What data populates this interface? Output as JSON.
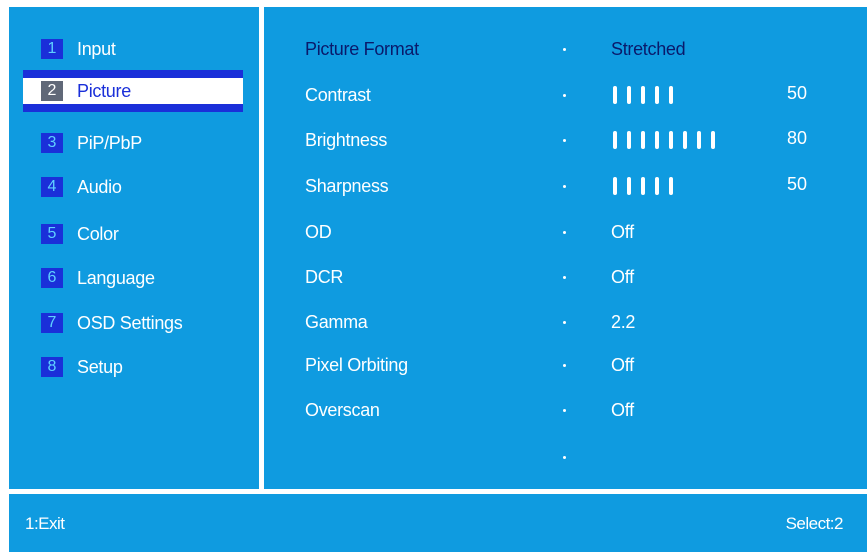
{
  "menu": [
    {
      "num": "1",
      "label": "Input"
    },
    {
      "num": "2",
      "label": "Picture"
    },
    {
      "num": "3",
      "label": "PiP/PbP"
    },
    {
      "num": "4",
      "label": "Audio"
    },
    {
      "num": "5",
      "label": "Color"
    },
    {
      "num": "6",
      "label": "Language"
    },
    {
      "num": "7",
      "label": "OSD Settings"
    },
    {
      "num": "8",
      "label": "Setup"
    }
  ],
  "settings": [
    {
      "name": "Picture Format",
      "value": "Stretched"
    },
    {
      "name": "Contrast",
      "bar_level": 50,
      "number": "50"
    },
    {
      "name": "Brightness",
      "bar_level": 80,
      "number": "80"
    },
    {
      "name": "Sharpness",
      "bar_level": 50,
      "number": "50"
    },
    {
      "name": "OD",
      "value": "Off"
    },
    {
      "name": "DCR",
      "value": "Off"
    },
    {
      "name": "Gamma",
      "value": "2.2"
    },
    {
      "name": "Pixel Orbiting",
      "value": "Off"
    },
    {
      "name": "Overscan",
      "value": "Off"
    }
  ],
  "footer": {
    "left": "1:Exit",
    "right": "Select:2"
  },
  "colors": {
    "background": "#0f9be0",
    "highlight": "#1a2fd9",
    "selected_text": "#0a1a6b"
  }
}
